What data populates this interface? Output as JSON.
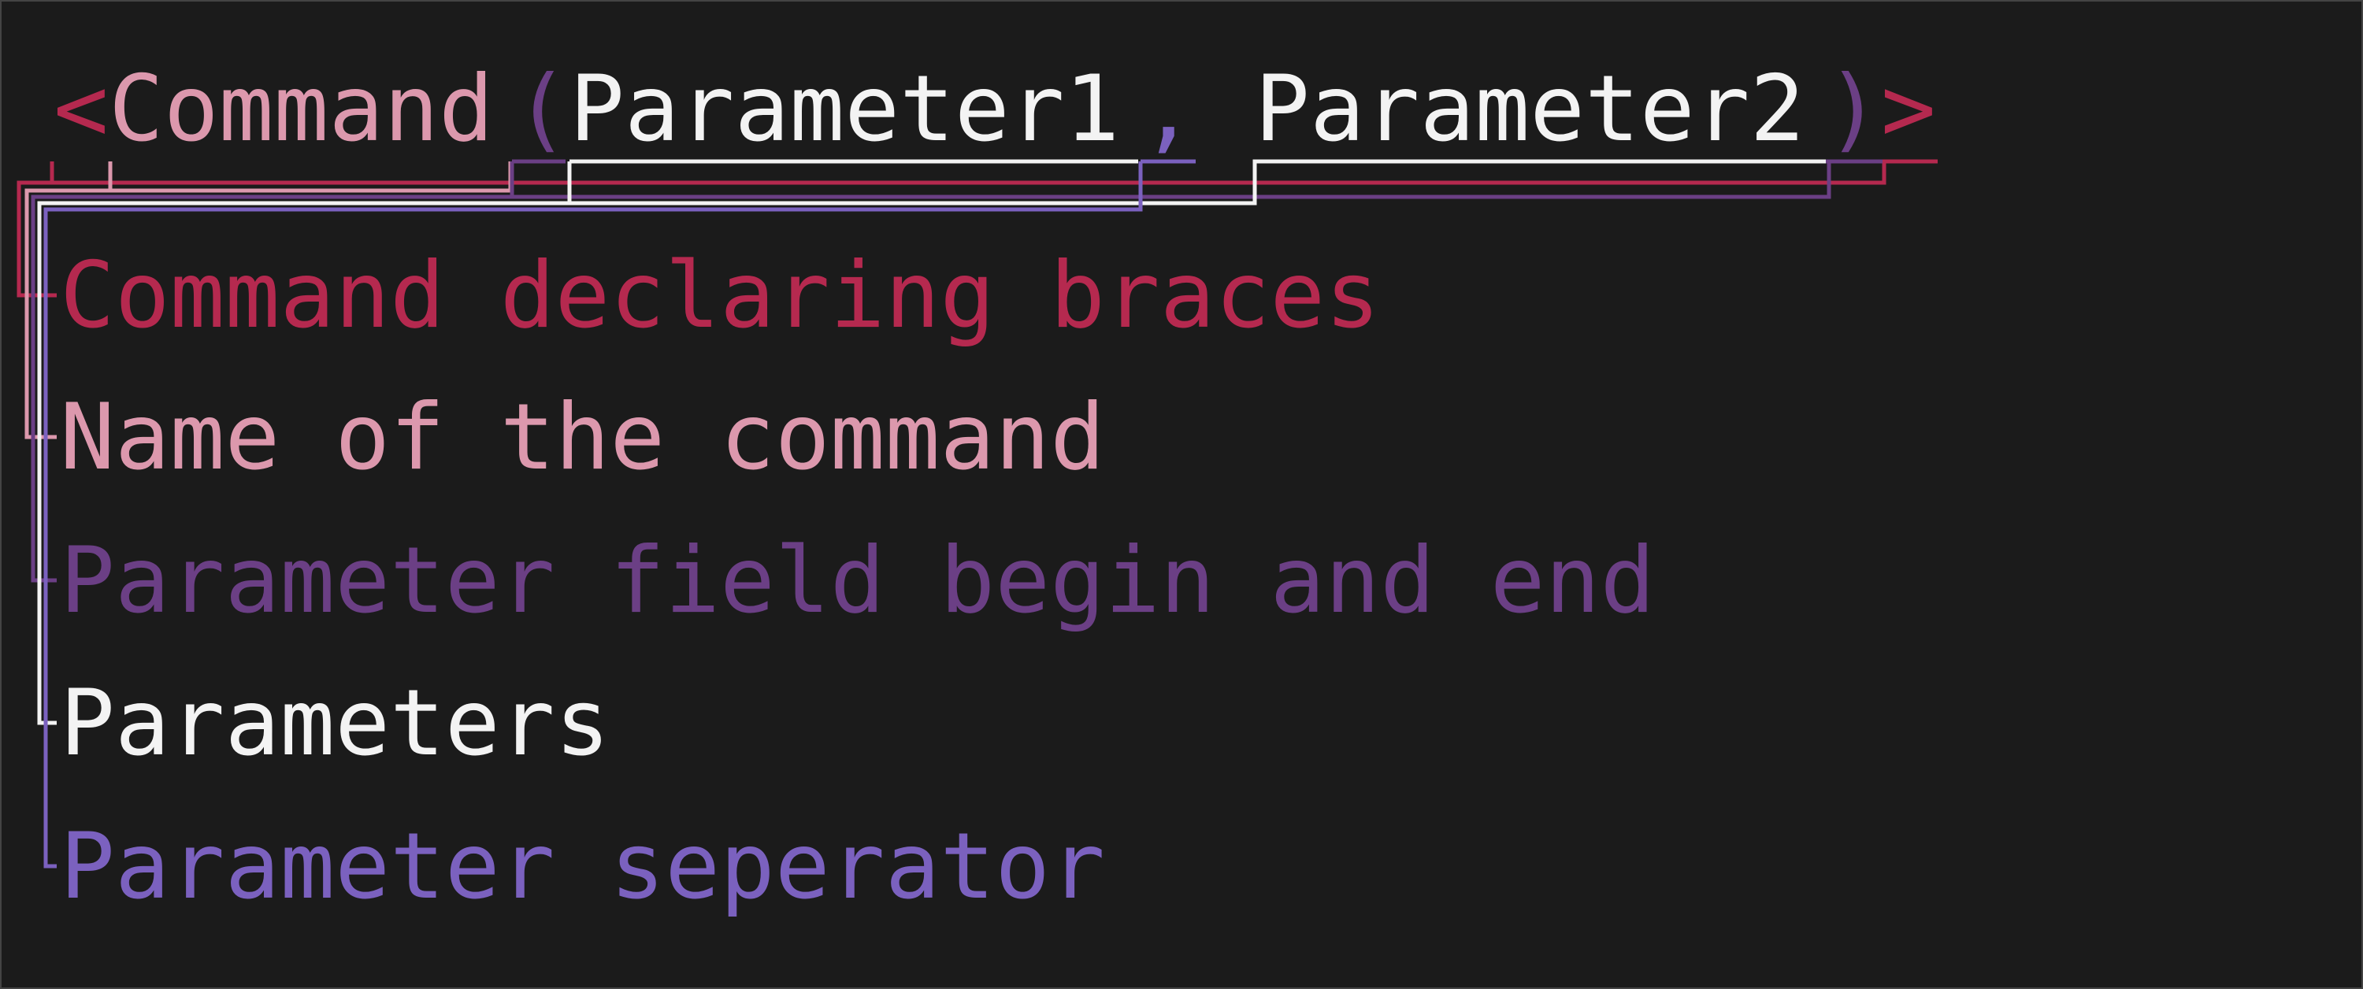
{
  "syntax": {
    "open_brace": "<",
    "command": "Command",
    "param_open": "(",
    "param1": "Parameter1",
    "separator": ",",
    "param2": "Parameter2",
    "param_close": ")",
    "close_brace": ">"
  },
  "legend": {
    "braces": "Command declaring braces",
    "name": "Name of the command",
    "field": "Parameter field begin and end",
    "params": "Parameters",
    "separator": "Parameter seperator"
  },
  "colors": {
    "background": "#1b1b1b",
    "braces": "#b5294f",
    "name": "#dc98ad",
    "field": "#6b3f85",
    "params": "#f3f3f3",
    "separator": "#7b61bf"
  }
}
